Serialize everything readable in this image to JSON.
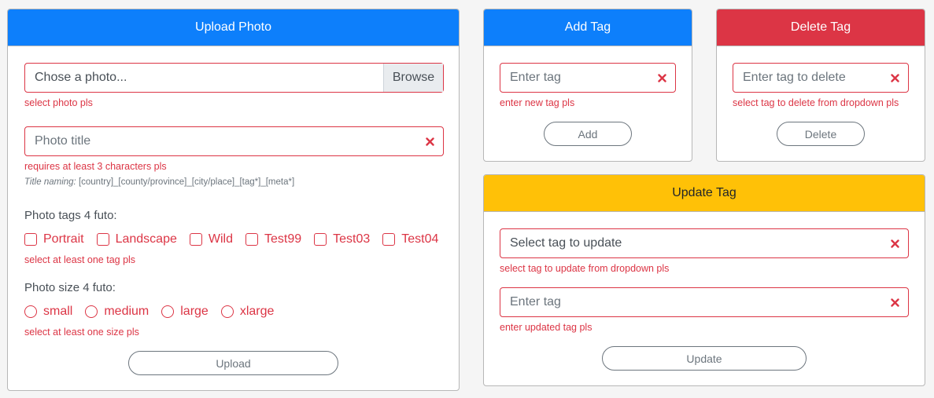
{
  "upload": {
    "title": "Upload Photo",
    "file_placeholder": "Chose a photo...",
    "browse_label": "Browse",
    "file_error": "select photo pls",
    "title_placeholder": "Photo title",
    "title_error": "requires at least 3 characters pls",
    "naming_label": "Title naming:",
    "naming_pattern": "[country]_[county/province]_[city/place]_[tag*]_[meta*]",
    "tags_label": "Photo tags 4 futo:",
    "tags": [
      "Portrait",
      "Landscape",
      "Wild",
      "Test99",
      "Test03",
      "Test04"
    ],
    "tags_error": "select at least one tag pls",
    "size_label": "Photo size 4 futo:",
    "sizes": [
      "small",
      "medium",
      "large",
      "xlarge"
    ],
    "size_error": "select at least one size pls",
    "submit_label": "Upload"
  },
  "add_tag": {
    "title": "Add Tag",
    "placeholder": "Enter tag",
    "error": "enter new tag pls",
    "button": "Add"
  },
  "delete_tag": {
    "title": "Delete Tag",
    "placeholder": "Enter tag to delete",
    "error": "select tag to delete from dropdown pls",
    "button": "Delete"
  },
  "update_tag": {
    "title": "Update Tag",
    "select_placeholder": "Select tag to update",
    "select_error": "select tag to update from dropdown pls",
    "input_placeholder": "Enter tag",
    "input_error": "enter updated tag pls",
    "button": "Update"
  },
  "colors": {
    "primary": "#0d7ffb",
    "danger": "#dc3545",
    "warning": "#ffc107"
  }
}
